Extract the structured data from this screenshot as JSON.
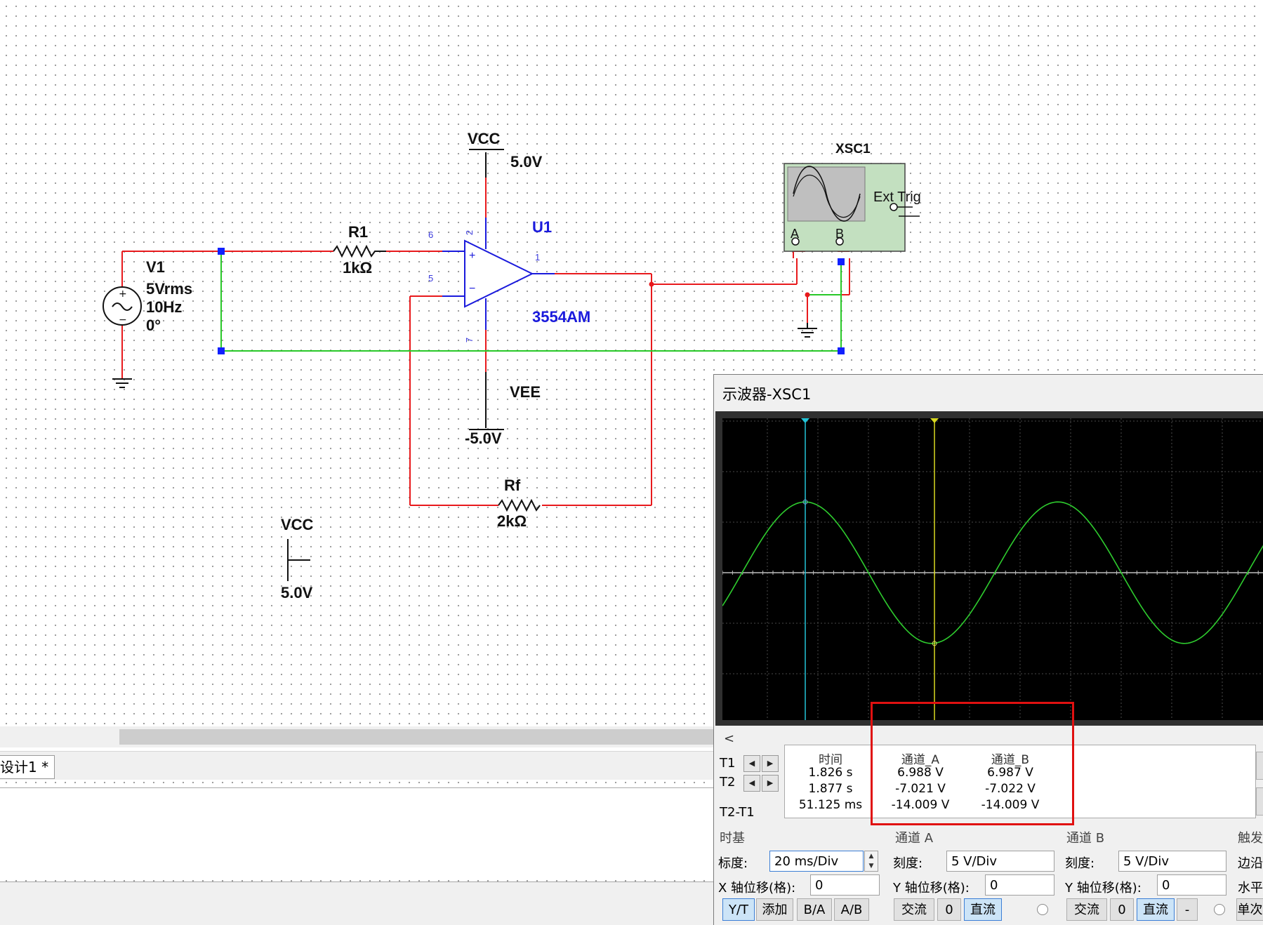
{
  "schematic": {
    "vcc_top": {
      "name": "VCC",
      "voltage": "5.0V"
    },
    "vee": {
      "name": "VEE",
      "voltage": "-5.0V"
    },
    "vcc_bottom": {
      "name": "VCC",
      "voltage": "5.0V"
    },
    "source": {
      "name": "V1",
      "amplitude": "5Vrms",
      "frequency": "10Hz",
      "phase": "0°"
    },
    "r1": {
      "name": "R1",
      "value": "1kΩ"
    },
    "rf": {
      "name": "Rf",
      "value": "2kΩ"
    },
    "opamp": {
      "name": "U1",
      "model": "3554AM",
      "pins": {
        "p6": "6",
        "p2": "2",
        "p5": "5",
        "p1": "1",
        "p7": "7"
      },
      "plus": "+",
      "minus": "−"
    },
    "scope_symbol": {
      "name": "XSC1",
      "ext_trig": "Ext Trig",
      "ch_a": "A",
      "ch_b": "B"
    },
    "colors": {
      "wire_red": "#e8191c",
      "wire_green": "#28c828",
      "component_blue": "#1a1adc",
      "junction_blue": "#1020ff",
      "scope_green": "#c3e0c0"
    }
  },
  "main_window": {
    "doc_tab": "设计1 *"
  },
  "scope_window": {
    "title": "示波器-XSC1",
    "scroll_left": "<",
    "readout": {
      "headers": [
        "时间",
        "通道_A",
        "通道_B"
      ],
      "rows": [
        {
          "label": "T1",
          "time": "1.826 s",
          "a": "6.988 V",
          "b": "6.987 V"
        },
        {
          "label": "T2",
          "time": "1.877 s",
          "a": "-7.021 V",
          "b": "-7.022 V"
        },
        {
          "label": "T2-T1",
          "time": "51.125 ms",
          "a": "-14.009 V",
          "b": "-14.009 V"
        }
      ]
    },
    "timebase": {
      "section": "时基",
      "scale_label": "标度:",
      "scale": "20 ms/Div",
      "xpos_label": "X 轴位移(格):",
      "xpos": "0",
      "buttons": [
        "Y/T",
        "添加",
        "B/A",
        "A/B"
      ]
    },
    "channel_a": {
      "section": "通道 A",
      "scale_label": "刻度:",
      "scale": "5  V/Div",
      "ypos_label": "Y 轴位移(格):",
      "ypos": "0",
      "buttons": [
        "交流",
        "0",
        "直流"
      ]
    },
    "channel_b": {
      "section": "通道 B",
      "scale_label": "刻度:",
      "scale": "5  V/Div",
      "ypos_label": "Y 轴位移(格):",
      "ypos": "0",
      "buttons": [
        "交流",
        "0",
        "直流",
        "-"
      ]
    },
    "trigger": {
      "section": "触发",
      "edge_label": "边沿",
      "level_label": "水平",
      "single_label": "单次"
    },
    "trace": {
      "color": "#2ecc2e",
      "amplitude_V": 7.0,
      "period_ms": 100,
      "volts_per_div": 5,
      "ms_per_div": 20
    },
    "cursor_colors": {
      "t1": "#22c4d8",
      "t2": "#d8d820"
    }
  }
}
